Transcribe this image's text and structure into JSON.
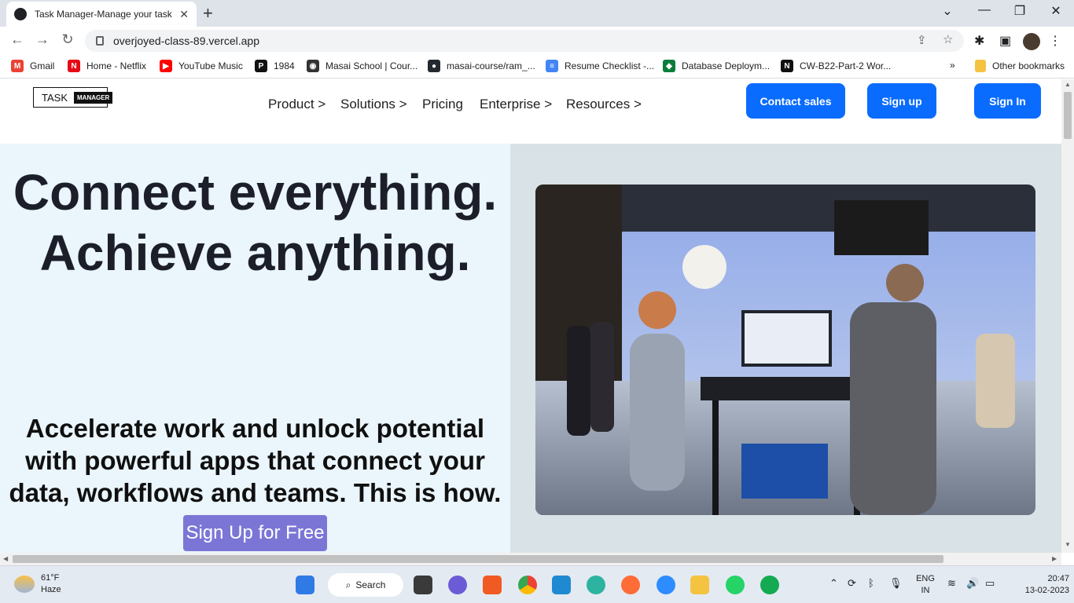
{
  "browser": {
    "tab_title": "Task Manager-Manage your task",
    "url": "overjoyed-class-89.vercel.app",
    "bookmarks": [
      {
        "label": "Gmail",
        "color": "#ea4335",
        "glyph": "M"
      },
      {
        "label": "Home - Netflix",
        "color": "#e50914",
        "glyph": "N"
      },
      {
        "label": "YouTube Music",
        "color": "#ff0000",
        "glyph": "▶"
      },
      {
        "label": "1984",
        "color": "#111111",
        "glyph": "P"
      },
      {
        "label": "Masai School | Cour...",
        "color": "#333333",
        "glyph": "◉"
      },
      {
        "label": "masai-course/ram_...",
        "color": "#24292f",
        "glyph": "●"
      },
      {
        "label": "Resume Checklist -...",
        "color": "#4285f4",
        "glyph": "≡"
      },
      {
        "label": "Database Deploym...",
        "color": "#0a7d3b",
        "glyph": "◆"
      },
      {
        "label": "CW-B22-Part-2 Wor...",
        "color": "#111111",
        "glyph": "N"
      }
    ],
    "more_bookmarks": "»",
    "other_bookmarks": "Other bookmarks"
  },
  "site": {
    "logo_text": "TASK",
    "logo_badge": "MANAGER",
    "nav": [
      "Product >",
      "Solutions >",
      "Pricing",
      "Enterprise >",
      "Resources >"
    ],
    "contact_label": "Contact sales",
    "signup_label": "Sign up",
    "signin_label": "Sign In",
    "headline": "Connect everything. Achieve anything.",
    "subheadline": "Accelerate work and unlock potential with powerful apps that connect your data, workflows and teams. This is how.",
    "cta_label": "Sign Up for Free",
    "accent_color": "#0a6cff",
    "cta_color": "#7b76d6"
  },
  "taskbar": {
    "temperature": "61°F",
    "weather": "Haze",
    "search_label": "Search",
    "language": "ENG",
    "region": "IN",
    "time": "20:47",
    "date": "13-02-2023"
  }
}
